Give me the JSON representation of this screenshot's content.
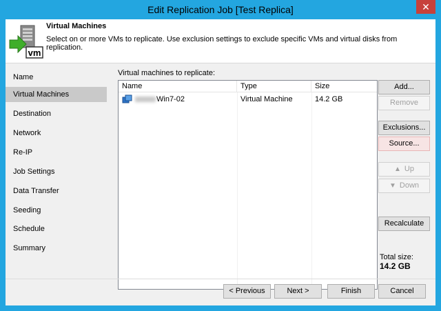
{
  "window": {
    "title": "Edit Replication Job [Test Replica]",
    "close_glyph": "✕"
  },
  "header": {
    "title": "Virtual Machines",
    "description": "Select on or more VMs to replicate. Use exclusion settings to exclude specific VMs and virtual disks from replication.",
    "icon": "vm-server-icon"
  },
  "nav": {
    "items": [
      {
        "label": "Name"
      },
      {
        "label": "Virtual Machines",
        "active": true
      },
      {
        "label": "Destination"
      },
      {
        "label": "Network"
      },
      {
        "label": "Re-IP"
      },
      {
        "label": "Job Settings"
      },
      {
        "label": "Data Transfer"
      },
      {
        "label": "Seeding"
      },
      {
        "label": "Schedule"
      },
      {
        "label": "Summary"
      }
    ]
  },
  "vm_list": {
    "label": "Virtual machines to replicate:",
    "columns": [
      "Name",
      "Type",
      "Size"
    ],
    "rows": [
      {
        "name": "Win7-02",
        "type": "Virtual Machine",
        "size": "14.2 GB"
      }
    ]
  },
  "side_buttons": {
    "add": "Add...",
    "remove": "Remove",
    "exclusions": "Exclusions...",
    "source": "Source...",
    "up": "Up",
    "down": "Down",
    "recalculate": "Recalculate"
  },
  "total": {
    "label": "Total size:",
    "value": "14.2 GB"
  },
  "footer": {
    "previous": "< Previous",
    "next": "Next >",
    "finish": "Finish",
    "cancel": "Cancel"
  },
  "colors": {
    "titlebar": "#23a6e0",
    "close": "#c7413b",
    "nav_active": "#c9c9c9",
    "source_highlight": "#f7e4e4"
  }
}
